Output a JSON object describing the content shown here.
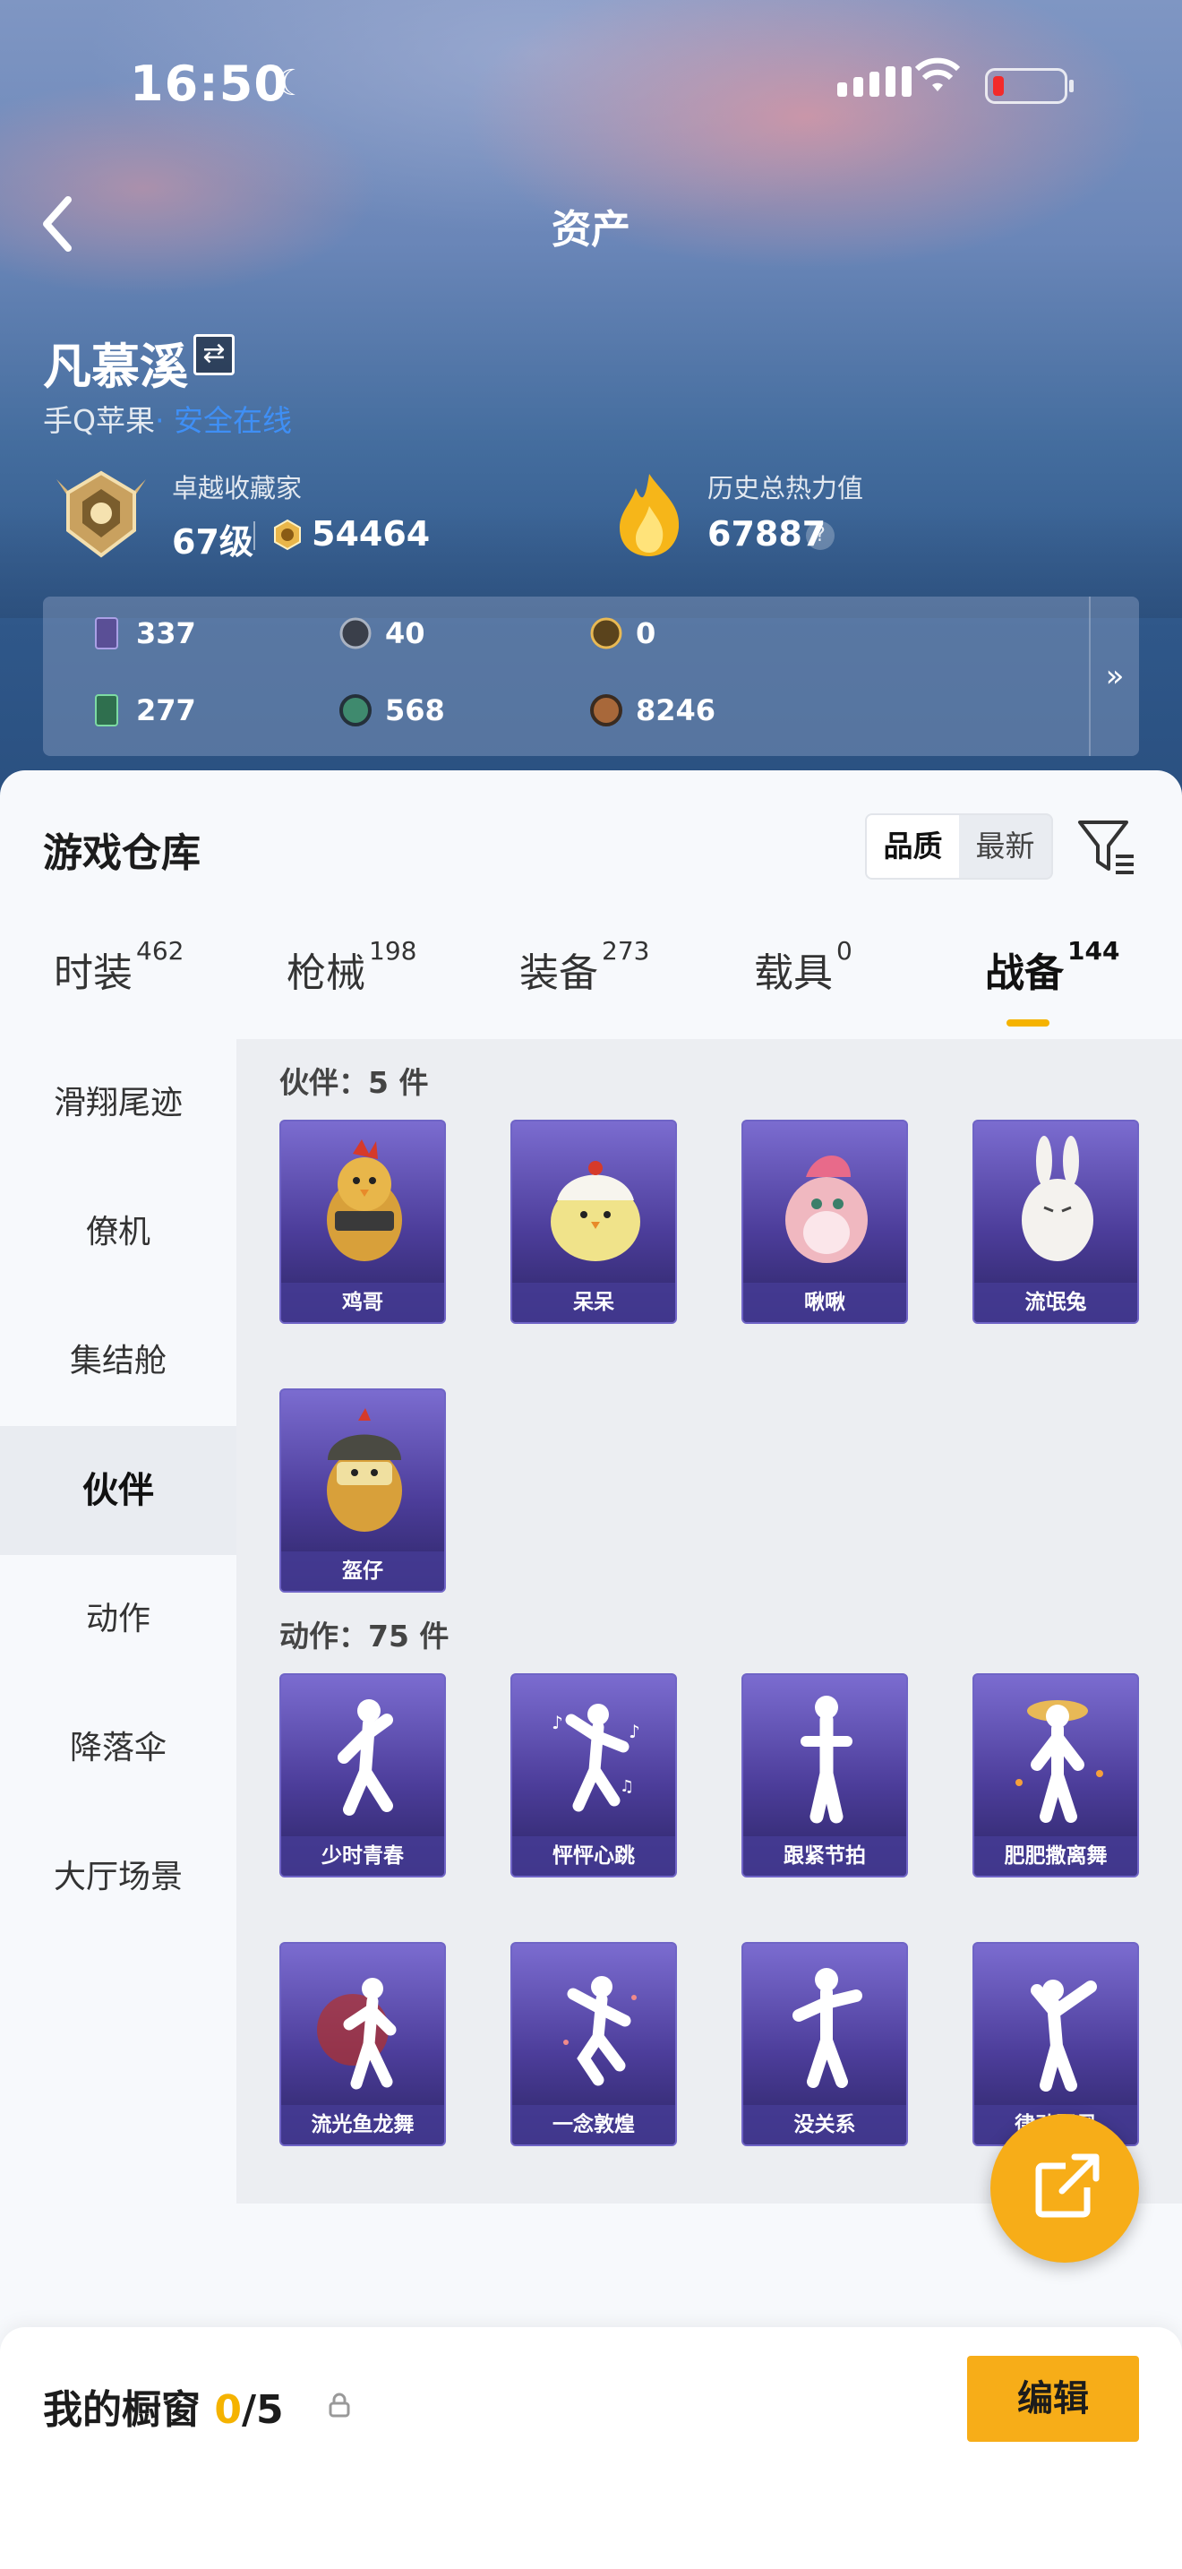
{
  "status_bar": {
    "time": "16:50"
  },
  "header": {
    "title": "资产"
  },
  "profile": {
    "name": "凡慕溪",
    "platform": "手Q苹果",
    "platform_link": "· 安全在线",
    "rank_title": "卓越收藏家",
    "level": "67级",
    "coins": "54464",
    "heat_label": "历史总热力值",
    "heat_value": "67887",
    "help_mark": "?"
  },
  "resources": {
    "row1": [
      "337",
      "40",
      "0"
    ],
    "row2": [
      "277",
      "568",
      "8246"
    ],
    "more": "»"
  },
  "warehouse": {
    "title": "游戏仓库",
    "sort": [
      "品质",
      "最新"
    ],
    "tabs": [
      {
        "label": "时装",
        "count": "462"
      },
      {
        "label": "枪械",
        "count": "198"
      },
      {
        "label": "装备",
        "count": "273"
      },
      {
        "label": "载具",
        "count": "0"
      },
      {
        "label": "战备",
        "count": "144"
      }
    ],
    "categories": [
      "滑翔尾迹",
      "僚机",
      "集结舱",
      "伙伴",
      "动作",
      "降落伞",
      "大厅场景"
    ],
    "sections": {
      "partners": {
        "title": "伙伴：5 件",
        "items": [
          "鸡哥",
          "呆呆",
          "啾啾",
          "流氓兔",
          "盔仔"
        ]
      },
      "actions": {
        "title": "动作：75 件",
        "items": [
          "少时青春",
          "怦怦心跳",
          "跟紧节拍",
          "肥肥撒离舞",
          "流光鱼龙舞",
          "一念敦煌",
          "没关系",
          "律动飓风"
        ]
      }
    }
  },
  "showcase": {
    "title": "我的橱窗",
    "current": "0",
    "total": "/5",
    "edit_label": "编辑"
  }
}
